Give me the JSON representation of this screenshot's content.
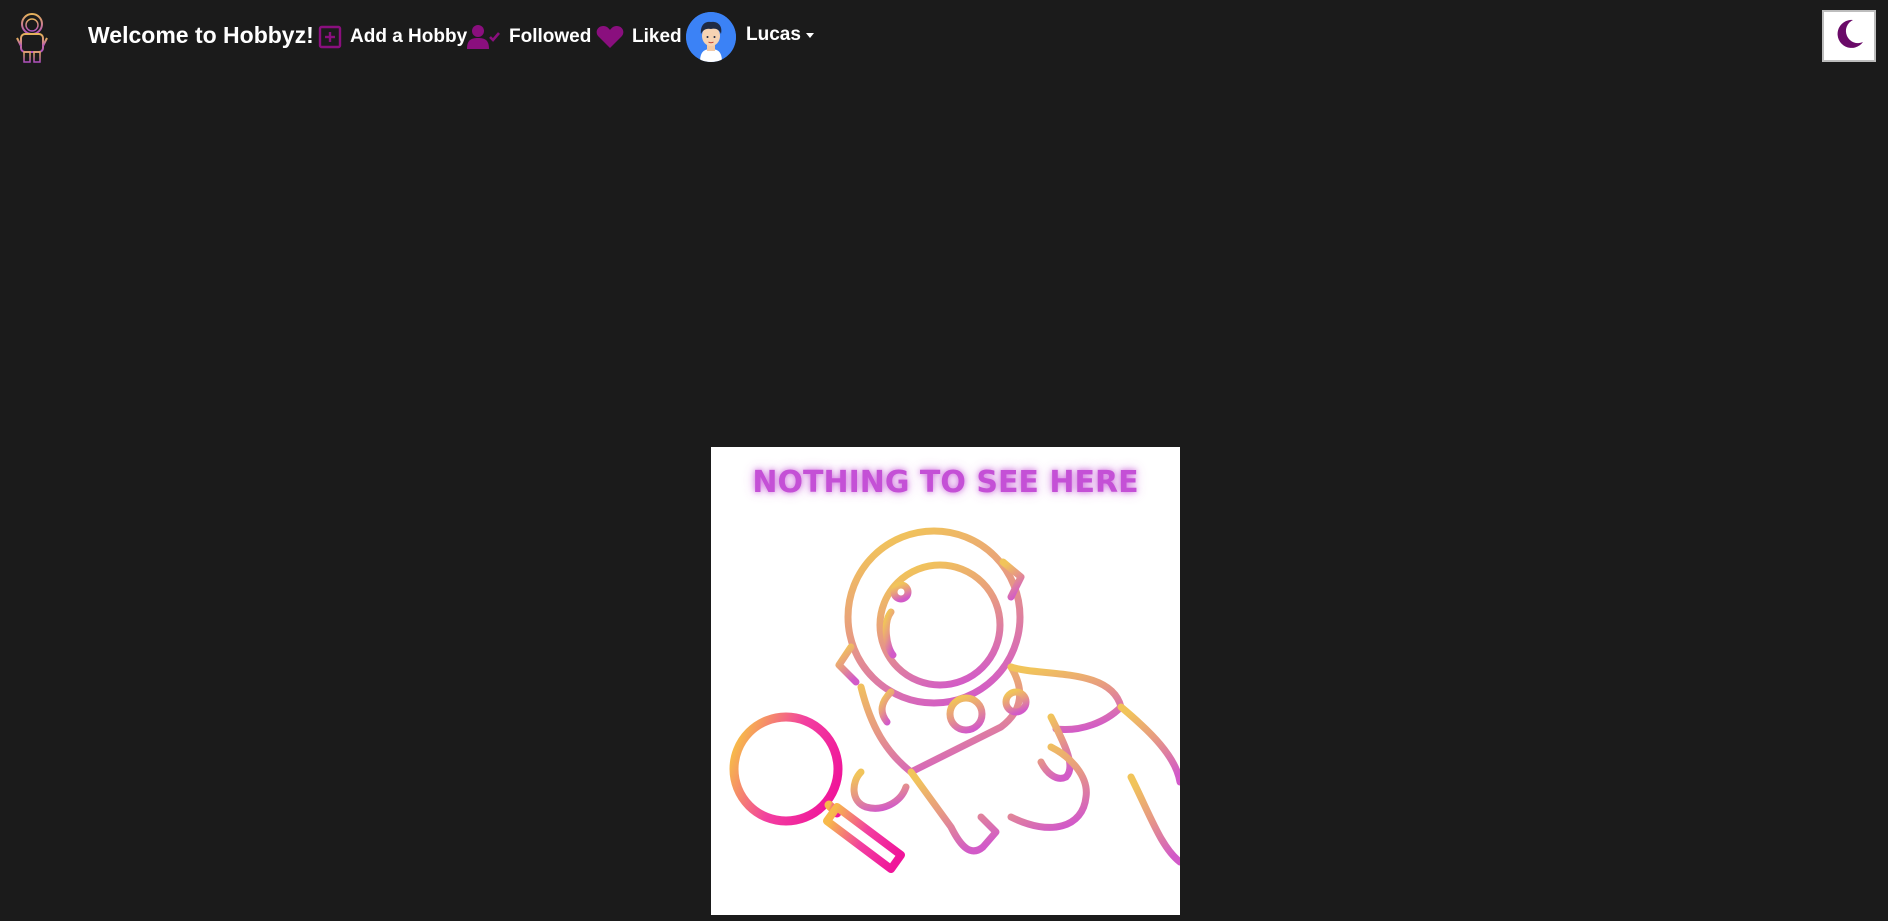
{
  "navbar": {
    "brand_title": "Welcome to Hobbyz!",
    "links": {
      "add_hobby": "Add a Hobby",
      "followed": "Followed",
      "liked": "Liked"
    },
    "user": {
      "name": "Lucas"
    },
    "theme_toggle_icon": "moon-icon"
  },
  "main": {
    "empty_state": {
      "title": "NOTHING TO SEE HERE",
      "illustration": "astronaut-with-magnifying-glass"
    }
  },
  "colors": {
    "background": "#1b1b1b",
    "accent_purple": "#8a0f7e",
    "avatar_blue": "#3b82f6",
    "glow_pink": "#c450d6"
  }
}
